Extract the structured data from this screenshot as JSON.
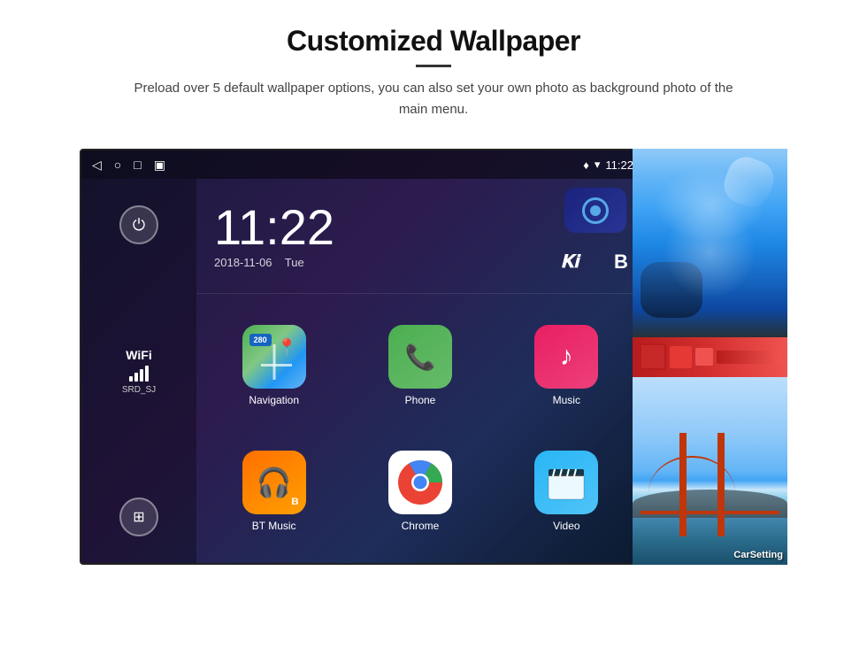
{
  "page": {
    "title": "Customized Wallpaper",
    "divider": true,
    "subtitle": "Preload over 5 default wallpaper options, you can also set your own photo as background photo of the main menu."
  },
  "status_bar": {
    "time": "11:22",
    "location_icon": "♦",
    "wifi_icon": "▾",
    "nav_back": "◁",
    "nav_home": "○",
    "nav_square": "□",
    "nav_photo": "▣"
  },
  "clock": {
    "time": "11:22",
    "date": "2018-11-06",
    "day": "Tue"
  },
  "wifi": {
    "label": "WiFi",
    "ssid": "SRD_SJ"
  },
  "apps": [
    {
      "id": "navigation",
      "label": "Navigation",
      "badge": "280"
    },
    {
      "id": "phone",
      "label": "Phone"
    },
    {
      "id": "music",
      "label": "Music"
    },
    {
      "id": "btmusic",
      "label": "BT Music"
    },
    {
      "id": "chrome",
      "label": "Chrome"
    },
    {
      "id": "video",
      "label": "Video"
    }
  ],
  "thumbnails": [
    {
      "id": "ice-cave",
      "label": ""
    },
    {
      "id": "red-strip",
      "label": ""
    },
    {
      "id": "bridge",
      "label": "CarSetting"
    }
  ]
}
